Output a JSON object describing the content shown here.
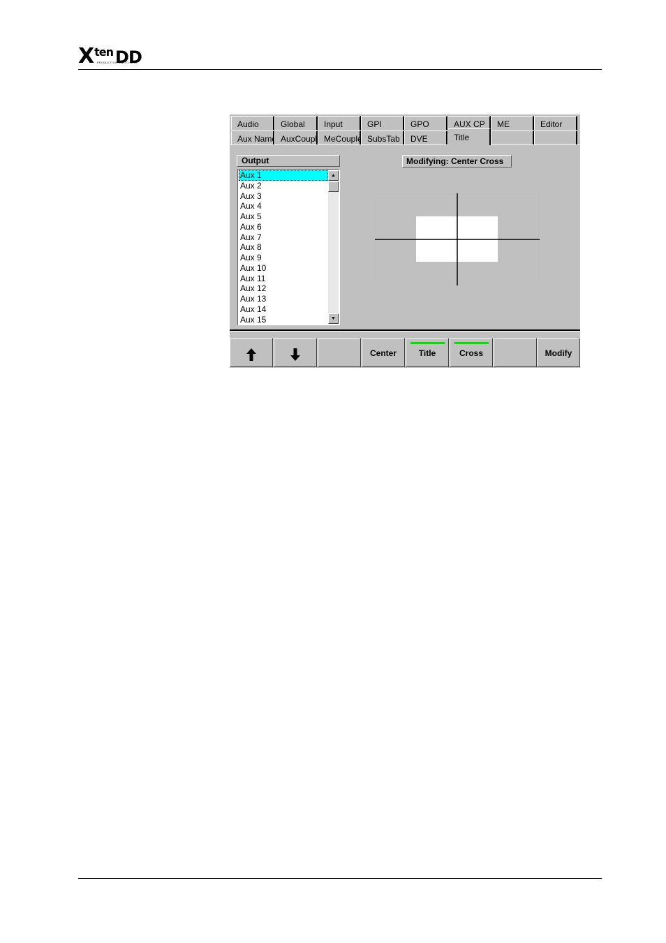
{
  "header": {
    "logo_main": "X",
    "logo_ten": "ten",
    "logo_dd": "DD",
    "logo_sub": "PRODUCTION SWITCHERS"
  },
  "tabs": {
    "row_back": [
      "Audio",
      "Global",
      "Input",
      "GPI",
      "GPO",
      "AUX CP",
      "ME",
      "Editor"
    ],
    "row_front": [
      "Aux Name",
      "AuxCouple",
      "MeCouple",
      "SubsTab",
      "DVE",
      "Title",
      "",
      ""
    ],
    "active": "Title"
  },
  "output": {
    "header": "Output",
    "items": [
      "Aux 1",
      "Aux 2",
      "Aux 3",
      "Aux 4",
      "Aux 5",
      "Aux 6",
      "Aux 7",
      "Aux 8",
      "Aux 9",
      "Aux 10",
      "Aux 11",
      "Aux 12",
      "Aux 13",
      "Aux 14",
      "Aux 15"
    ],
    "selected": "Aux 1"
  },
  "modifying_label": "Modifying: Center Cross",
  "buttons": [
    {
      "label": "",
      "icon": "arrow-up-icon"
    },
    {
      "label": "",
      "icon": "arrow-down-icon"
    },
    {
      "label": ""
    },
    {
      "label": "Center"
    },
    {
      "label": "Title",
      "active": true
    },
    {
      "label": "Cross",
      "active": true
    },
    {
      "label": ""
    },
    {
      "label": "Modify"
    }
  ],
  "colors": {
    "selection": "#00ffff",
    "indicator": "#00e000",
    "panel": "#c0c0c0"
  }
}
